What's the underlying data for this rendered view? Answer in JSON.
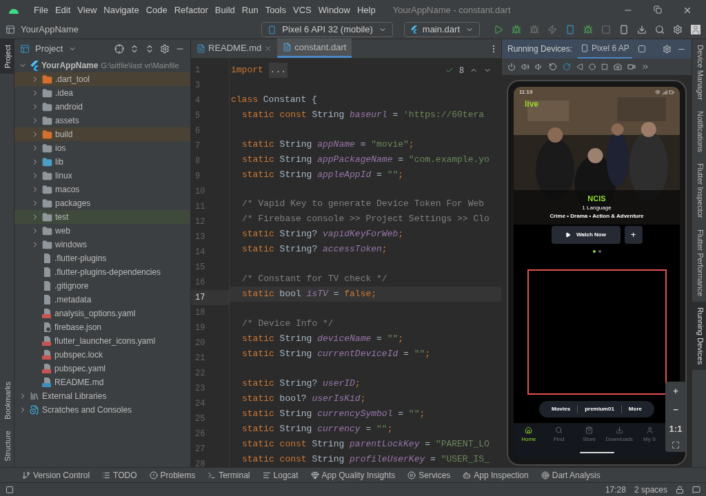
{
  "title_bar": {
    "menu": [
      "File",
      "Edit",
      "View",
      "Navigate",
      "Code",
      "Refactor",
      "Build",
      "Run",
      "Tools",
      "VCS",
      "Window",
      "Help"
    ],
    "title": "YourAppName - constant.dart"
  },
  "toolbar": {
    "project": "YourAppName",
    "device": "Pixel 6 API 32 (mobile)",
    "config": "main.dart"
  },
  "left_strip": {
    "top": [
      {
        "label": "Project",
        "selected": true
      }
    ],
    "bottom": [
      {
        "label": "Bookmarks",
        "selected": false
      },
      {
        "label": "Structure",
        "selected": false
      }
    ]
  },
  "project_panel": {
    "title": "Project",
    "tree": [
      {
        "label": "YourAppName",
        "path": "G:\\sitfile\\last vr\\Mainfile",
        "kind": "flutter",
        "expanded": true,
        "excluded": false,
        "children": [
          {
            "label": ".dart_tool",
            "kind": "folder-excluded",
            "expanded": false,
            "excluded": true
          },
          {
            "label": ".idea",
            "kind": "folder",
            "expanded": false,
            "excluded": false
          },
          {
            "label": "android",
            "kind": "folder-module",
            "expanded": false,
            "excluded": false
          },
          {
            "label": "assets",
            "kind": "folder",
            "expanded": false,
            "excluded": false
          },
          {
            "label": "build",
            "kind": "folder-excluded",
            "expanded": false,
            "excluded": true
          },
          {
            "label": "ios",
            "kind": "folder-module",
            "expanded": false,
            "excluded": false
          },
          {
            "label": "lib",
            "kind": "folder-source",
            "expanded": false,
            "excluded": false
          },
          {
            "label": "linux",
            "kind": "folder",
            "expanded": false,
            "excluded": false
          },
          {
            "label": "macos",
            "kind": "folder",
            "expanded": false,
            "excluded": false
          },
          {
            "label": "packages",
            "kind": "folder",
            "expanded": false,
            "excluded": false
          },
          {
            "label": "test",
            "kind": "folder-test",
            "expanded": false,
            "excluded": false
          },
          {
            "label": "web",
            "kind": "folder-web",
            "expanded": false,
            "excluded": false
          },
          {
            "label": "windows",
            "kind": "folder",
            "expanded": false,
            "excluded": false
          },
          {
            "label": ".flutter-plugins",
            "kind": "file",
            "excluded": false
          },
          {
            "label": ".flutter-plugins-dependencies",
            "kind": "file",
            "excluded": false
          },
          {
            "label": ".gitignore",
            "kind": "file",
            "excluded": false
          },
          {
            "label": ".metadata",
            "kind": "file",
            "excluded": false
          },
          {
            "label": "analysis_options.yaml",
            "kind": "yaml",
            "excluded": false
          },
          {
            "label": "firebase.json",
            "kind": "json",
            "excluded": false
          },
          {
            "label": "flutter_launcher_icons.yaml",
            "kind": "yaml",
            "excluded": false
          },
          {
            "label": "pubspec.lock",
            "kind": "yaml",
            "excluded": false
          },
          {
            "label": "pubspec.yaml",
            "kind": "yaml",
            "excluded": false
          },
          {
            "label": "README.md",
            "kind": "md",
            "excluded": false
          }
        ]
      },
      {
        "label": "External Libraries",
        "kind": "libraries",
        "expanded": false,
        "excluded": false
      },
      {
        "label": "Scratches and Consoles",
        "kind": "scratches",
        "expanded": false,
        "excluded": false
      }
    ]
  },
  "editor": {
    "tabs": [
      {
        "label": "README.md",
        "kind": "md",
        "selected": false
      },
      {
        "label": "constant.dart",
        "kind": "dart",
        "selected": true
      }
    ],
    "problems": "8",
    "lines": [
      {
        "number": "1",
        "current": false,
        "indent": false,
        "tokens": [
          {
            "kind": "keyword",
            "text": "import "
          },
          {
            "kind": "fold",
            "text": "..."
          }
        ]
      },
      {
        "number": "3",
        "current": false
      },
      {
        "number": "4",
        "current": false,
        "indent": false,
        "tokens": [
          {
            "kind": "keyword",
            "text": "class "
          },
          {
            "kind": "plain",
            "text": "Constant {"
          }
        ]
      },
      {
        "number": "5",
        "current": false,
        "indent": true,
        "tokens": [
          {
            "kind": "keyword",
            "text": "static const "
          },
          {
            "kind": "plain",
            "text": "String "
          },
          {
            "kind": "field",
            "text": "baseurl"
          },
          {
            "kind": "plain",
            "text": " = "
          },
          {
            "kind": "string",
            "text": "'https://60tera"
          }
        ]
      },
      {
        "number": "6",
        "current": false
      },
      {
        "number": "7",
        "current": false,
        "indent": true,
        "tokens": [
          {
            "kind": "keyword",
            "text": "static "
          },
          {
            "kind": "plain",
            "text": "String "
          },
          {
            "kind": "field",
            "text": "appName"
          },
          {
            "kind": "plain",
            "text": " = "
          },
          {
            "kind": "string",
            "text": "\"movie\""
          },
          {
            "kind": "keyword",
            "text": ";"
          }
        ]
      },
      {
        "number": "8",
        "current": false,
        "indent": true,
        "tokens": [
          {
            "kind": "keyword",
            "text": "static "
          },
          {
            "kind": "plain",
            "text": "String "
          },
          {
            "kind": "field",
            "text": "appPackageName"
          },
          {
            "kind": "plain",
            "text": " = "
          },
          {
            "kind": "string",
            "text": "\"com.example.yo"
          }
        ]
      },
      {
        "number": "9",
        "current": false,
        "indent": true,
        "tokens": [
          {
            "kind": "keyword",
            "text": "static "
          },
          {
            "kind": "plain",
            "text": "String "
          },
          {
            "kind": "field",
            "text": "appleAppId"
          },
          {
            "kind": "plain",
            "text": " = "
          },
          {
            "kind": "string",
            "text": "\"\""
          },
          {
            "kind": "keyword",
            "text": ";"
          }
        ]
      },
      {
        "number": "10",
        "current": false
      },
      {
        "number": "11",
        "current": false,
        "indent": true,
        "tokens": [
          {
            "kind": "comment",
            "text": "/* Vapid Key to generate Device Token For Web"
          }
        ]
      },
      {
        "number": "12",
        "current": false,
        "indent": true,
        "tokens": [
          {
            "kind": "comment",
            "text": "/* Firebase console >> Project Settings >> Clo"
          }
        ]
      },
      {
        "number": "13",
        "current": false,
        "indent": true,
        "tokens": [
          {
            "kind": "keyword",
            "text": "static "
          },
          {
            "kind": "plain",
            "text": "String? "
          },
          {
            "kind": "field",
            "text": "vapidKeyForWeb"
          },
          {
            "kind": "keyword",
            "text": ";"
          }
        ]
      },
      {
        "number": "14",
        "current": false,
        "indent": true,
        "tokens": [
          {
            "kind": "keyword",
            "text": "static "
          },
          {
            "kind": "plain",
            "text": "String? "
          },
          {
            "kind": "field",
            "text": "accessToken"
          },
          {
            "kind": "keyword",
            "text": ";"
          }
        ]
      },
      {
        "number": "15",
        "current": false
      },
      {
        "number": "16",
        "current": false,
        "indent": true,
        "tokens": [
          {
            "kind": "comment",
            "text": "/* Constant for TV check */"
          }
        ]
      },
      {
        "number": "17",
        "current": true,
        "indent": true,
        "tokens": [
          {
            "kind": "keyword",
            "text": "static "
          },
          {
            "kind": "plain",
            "text": "bool "
          },
          {
            "kind": "field",
            "text": "isTV"
          },
          {
            "kind": "plain",
            "text": " = "
          },
          {
            "kind": "keyword",
            "text": "false;"
          }
        ]
      },
      {
        "number": "18",
        "current": false
      },
      {
        "number": "19",
        "current": false,
        "indent": true,
        "tokens": [
          {
            "kind": "comment",
            "text": "/* Device Info */"
          }
        ]
      },
      {
        "number": "20",
        "current": false,
        "indent": true,
        "tokens": [
          {
            "kind": "keyword",
            "text": "static "
          },
          {
            "kind": "plain",
            "text": "String "
          },
          {
            "kind": "field",
            "text": "deviceName"
          },
          {
            "kind": "plain",
            "text": " = "
          },
          {
            "kind": "string",
            "text": "\"\""
          },
          {
            "kind": "keyword",
            "text": ";"
          }
        ]
      },
      {
        "number": "21",
        "current": false,
        "indent": true,
        "tokens": [
          {
            "kind": "keyword",
            "text": "static "
          },
          {
            "kind": "plain",
            "text": "String "
          },
          {
            "kind": "field",
            "text": "currentDeviceId"
          },
          {
            "kind": "plain",
            "text": " = "
          },
          {
            "kind": "string",
            "text": "\"\""
          },
          {
            "kind": "keyword",
            "text": ";"
          }
        ]
      },
      {
        "number": "22",
        "current": false
      },
      {
        "number": "23",
        "current": false,
        "indent": true,
        "tokens": [
          {
            "kind": "keyword",
            "text": "static "
          },
          {
            "kind": "plain",
            "text": "String? "
          },
          {
            "kind": "field",
            "text": "userID"
          },
          {
            "kind": "keyword",
            "text": ";"
          }
        ]
      },
      {
        "number": "24",
        "current": false,
        "indent": true,
        "tokens": [
          {
            "kind": "keyword",
            "text": "static "
          },
          {
            "kind": "plain",
            "text": "bool? "
          },
          {
            "kind": "field",
            "text": "userIsKid"
          },
          {
            "kind": "keyword",
            "text": ";"
          }
        ]
      },
      {
        "number": "25",
        "current": false,
        "indent": true,
        "tokens": [
          {
            "kind": "keyword",
            "text": "static "
          },
          {
            "kind": "plain",
            "text": "String "
          },
          {
            "kind": "field",
            "text": "currencySymbol"
          },
          {
            "kind": "plain",
            "text": " = "
          },
          {
            "kind": "string",
            "text": "\"\""
          },
          {
            "kind": "keyword",
            "text": ";"
          }
        ]
      },
      {
        "number": "26",
        "current": false,
        "indent": true,
        "tokens": [
          {
            "kind": "keyword",
            "text": "static "
          },
          {
            "kind": "plain",
            "text": "String "
          },
          {
            "kind": "field",
            "text": "currency"
          },
          {
            "kind": "plain",
            "text": " = "
          },
          {
            "kind": "string",
            "text": "\"\""
          },
          {
            "kind": "keyword",
            "text": ";"
          }
        ]
      },
      {
        "number": "27",
        "current": false,
        "indent": true,
        "tokens": [
          {
            "kind": "keyword",
            "text": "static const "
          },
          {
            "kind": "plain",
            "text": "String "
          },
          {
            "kind": "field",
            "text": "parentLockKey"
          },
          {
            "kind": "plain",
            "text": " = "
          },
          {
            "kind": "string",
            "text": "\"PARENT_LO"
          }
        ]
      },
      {
        "number": "28",
        "current": false,
        "indent": true,
        "tokens": [
          {
            "kind": "keyword",
            "text": "static const "
          },
          {
            "kind": "plain",
            "text": "String "
          },
          {
            "kind": "field",
            "text": "profileUserKey"
          },
          {
            "kind": "plain",
            "text": " = "
          },
          {
            "kind": "string",
            "text": "\"USER_IS_"
          }
        ]
      }
    ]
  },
  "devices": {
    "title": "Running Devices:",
    "tabs": [
      {
        "label": "Pixel 6 AP",
        "selected": true
      }
    ],
    "phone": {
      "time": "11:19",
      "logo": "live",
      "show_title": "NCIS",
      "languages": "1 Language",
      "genres": "Crime • Drama • Action & Adventure",
      "watch": "Watch Now",
      "add": "+",
      "dots": [
        {
          "selected": true
        },
        {
          "selected": false
        }
      ],
      "chips": [
        "Movies",
        "premium01",
        "More"
      ],
      "nav": [
        {
          "label": "Home",
          "kind": "home",
          "selected": true
        },
        {
          "label": "Find",
          "kind": "find",
          "selected": false
        },
        {
          "label": "Store",
          "kind": "store",
          "selected": false
        },
        {
          "label": "Downloads",
          "kind": "downloads",
          "selected": false
        },
        {
          "label": "My S",
          "kind": "profile",
          "selected": false
        }
      ]
    },
    "zoom": [
      "+",
      "−",
      "1:1"
    ]
  },
  "right_strip": [
    {
      "label": "Device Manager",
      "selected": false
    },
    {
      "label": "Notifications",
      "selected": false
    },
    {
      "label": "Flutter Inspector",
      "selected": false
    },
    {
      "label": "Flutter Performance",
      "selected": false
    },
    {
      "label": "Running Devices",
      "selected": true
    }
  ],
  "tool_windows": [
    {
      "label": "Version Control",
      "kind": "vcs"
    },
    {
      "label": "TODO",
      "kind": "todo"
    },
    {
      "label": "Problems",
      "kind": "problems"
    },
    {
      "label": "Terminal",
      "kind": "terminal"
    },
    {
      "label": "Logcat",
      "kind": "logcat"
    },
    {
      "label": "App Quality Insights",
      "kind": "insights"
    },
    {
      "label": "Services",
      "kind": "services"
    },
    {
      "label": "App Inspection",
      "kind": "inspection"
    },
    {
      "label": "Dart Analysis",
      "kind": "dart"
    }
  ],
  "status_bar": {
    "position": "17:28",
    "indent": "2 spaces"
  }
}
